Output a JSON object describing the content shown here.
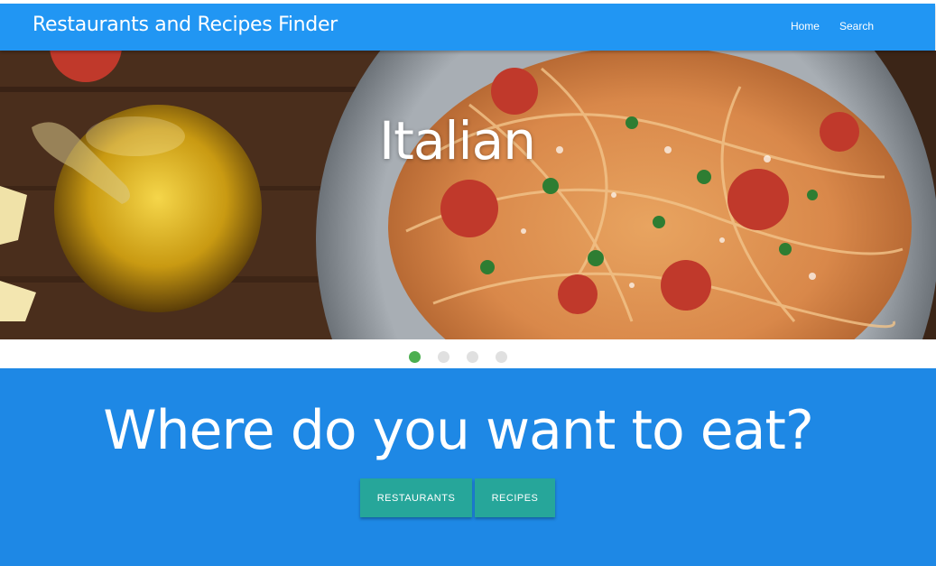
{
  "navbar": {
    "brand": "Restaurants and Recipes Finder",
    "links": [
      {
        "label": "Home"
      },
      {
        "label": "Search"
      }
    ],
    "color": "#2196f3"
  },
  "carousel": {
    "slide_title": "Italian",
    "indicators": [
      {
        "active": true
      },
      {
        "active": false
      },
      {
        "active": false
      },
      {
        "active": false
      }
    ],
    "active_color": "#4caf50"
  },
  "hero": {
    "title": "Where do you want to eat?",
    "buttons": [
      {
        "label": "RESTAURANTS"
      },
      {
        "label": "RECIPES"
      }
    ],
    "background": "#1e88e5",
    "button_color": "#26a69a"
  }
}
